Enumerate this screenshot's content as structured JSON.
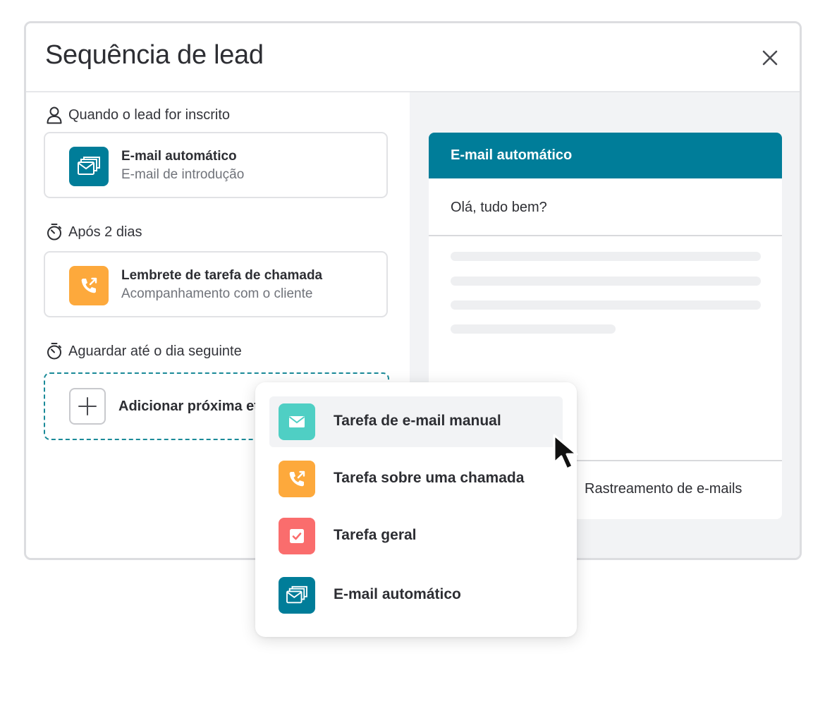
{
  "modal": {
    "title": "Sequência de lead"
  },
  "steps": [
    {
      "trigger": "Quando o lead for inscrito",
      "trigger_icon": "person-icon",
      "title": "E-mail automático",
      "subtitle": "E-mail de introdução",
      "icon": "email-stack-icon"
    },
    {
      "trigger": "Após 2 dias",
      "trigger_icon": "timer-icon",
      "title": "Lembrete de tarefa de chamada",
      "subtitle": "Acompanhamento com o cliente",
      "icon": "phone-callback-icon"
    }
  ],
  "next_step": {
    "trigger": "Aguardar até o dia seguinte",
    "trigger_icon": "timer-icon",
    "label": "Adicionar próxima et"
  },
  "preview": {
    "header": "E-mail automático",
    "subject": "Olá, tudo bem?",
    "footer": "Rastreamento de e-mails"
  },
  "dropdown": {
    "items": [
      {
        "label": "Tarefa de e-mail manual",
        "icon": "envelope-icon",
        "color": "#4fcfc4",
        "active": true
      },
      {
        "label": "Tarefa sobre uma chamada",
        "icon": "phone-callback-icon",
        "color": "#fda93c",
        "active": false
      },
      {
        "label": "Tarefa geral",
        "icon": "checkbox-icon",
        "color": "#fa6d6d",
        "active": false
      },
      {
        "label": "E-mail automático",
        "icon": "email-stack-icon",
        "color": "#007d99",
        "active": false
      }
    ]
  },
  "colors": {
    "teal": "#007d99",
    "orange": "#fda93c",
    "mint": "#4fcfc4",
    "coral": "#fa6d6d"
  }
}
